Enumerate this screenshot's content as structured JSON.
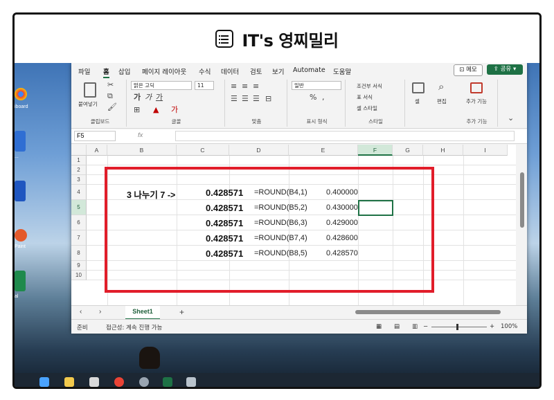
{
  "header": {
    "title": "IT's 영찌밀리",
    "icon": "list-icon"
  },
  "ribbon_tabs": [
    {
      "label": "파일"
    },
    {
      "label": "홈",
      "active": true
    },
    {
      "label": "삽입"
    },
    {
      "label": "페이지 레이아웃"
    },
    {
      "label": "수식"
    },
    {
      "label": "데이터"
    },
    {
      "label": "검토"
    },
    {
      "label": "보기"
    },
    {
      "label": "Automate"
    },
    {
      "label": "도움말"
    }
  ],
  "top_right": {
    "memo": "메모",
    "share": "공유"
  },
  "ribbon": {
    "clipboard": {
      "paste": "붙여넣기",
      "label": "클립보드"
    },
    "font": {
      "name": "맑은 고딕",
      "size": "11",
      "label": "글꼴"
    },
    "alignment": {
      "label": "맞춤"
    },
    "number": {
      "format": "일반",
      "label": "표시 형식"
    },
    "styles": {
      "conditional": "조건부 서식",
      "table": "표 서식",
      "cell_style": "셀 스타일",
      "label": "스타일"
    },
    "cells": {
      "label": "셀"
    },
    "editing": {
      "label": "편집"
    },
    "addins": {
      "button": "추가 기능",
      "label": "추가 기능"
    }
  },
  "formula_bar": {
    "name_box": "F5",
    "fx": "fx",
    "content": ""
  },
  "columns": [
    "A",
    "B",
    "C",
    "D",
    "E",
    "F",
    "G",
    "H",
    "I"
  ],
  "selected_column": "F",
  "rows": [
    "1",
    "2",
    "3",
    "4",
    "5",
    "6",
    "7",
    "8",
    "9",
    "10"
  ],
  "selected_row": "5",
  "sheet": {
    "label_cell": "3 나누기 7  ->",
    "data_rows": [
      {
        "row": "4",
        "value": "0.428571",
        "formula": "=ROUND(B4,1)",
        "result": "0.400000"
      },
      {
        "row": "5",
        "value": "0.428571",
        "formula": "=ROUND(B5,2)",
        "result": "0.430000"
      },
      {
        "row": "6",
        "value": "0.428571",
        "formula": "=ROUND(B6,3)",
        "result": "0.429000"
      },
      {
        "row": "7",
        "value": "0.428571",
        "formula": "=ROUND(B7,4)",
        "result": "0.428600"
      },
      {
        "row": "8",
        "value": "0.428571",
        "formula": "=ROUND(B8,5)",
        "result": "0.428570"
      }
    ]
  },
  "sheet_tab": "Sheet1",
  "status_bar": {
    "ready": "준비",
    "accessibility": "접근성: 계속 진행 가능",
    "zoom": "100%"
  },
  "desktop_labels": [
    "iboard",
    "...",
    "Paint",
    "al"
  ],
  "colors": {
    "excel_green": "#1e7145",
    "highlight_red": "#e11d2a"
  }
}
